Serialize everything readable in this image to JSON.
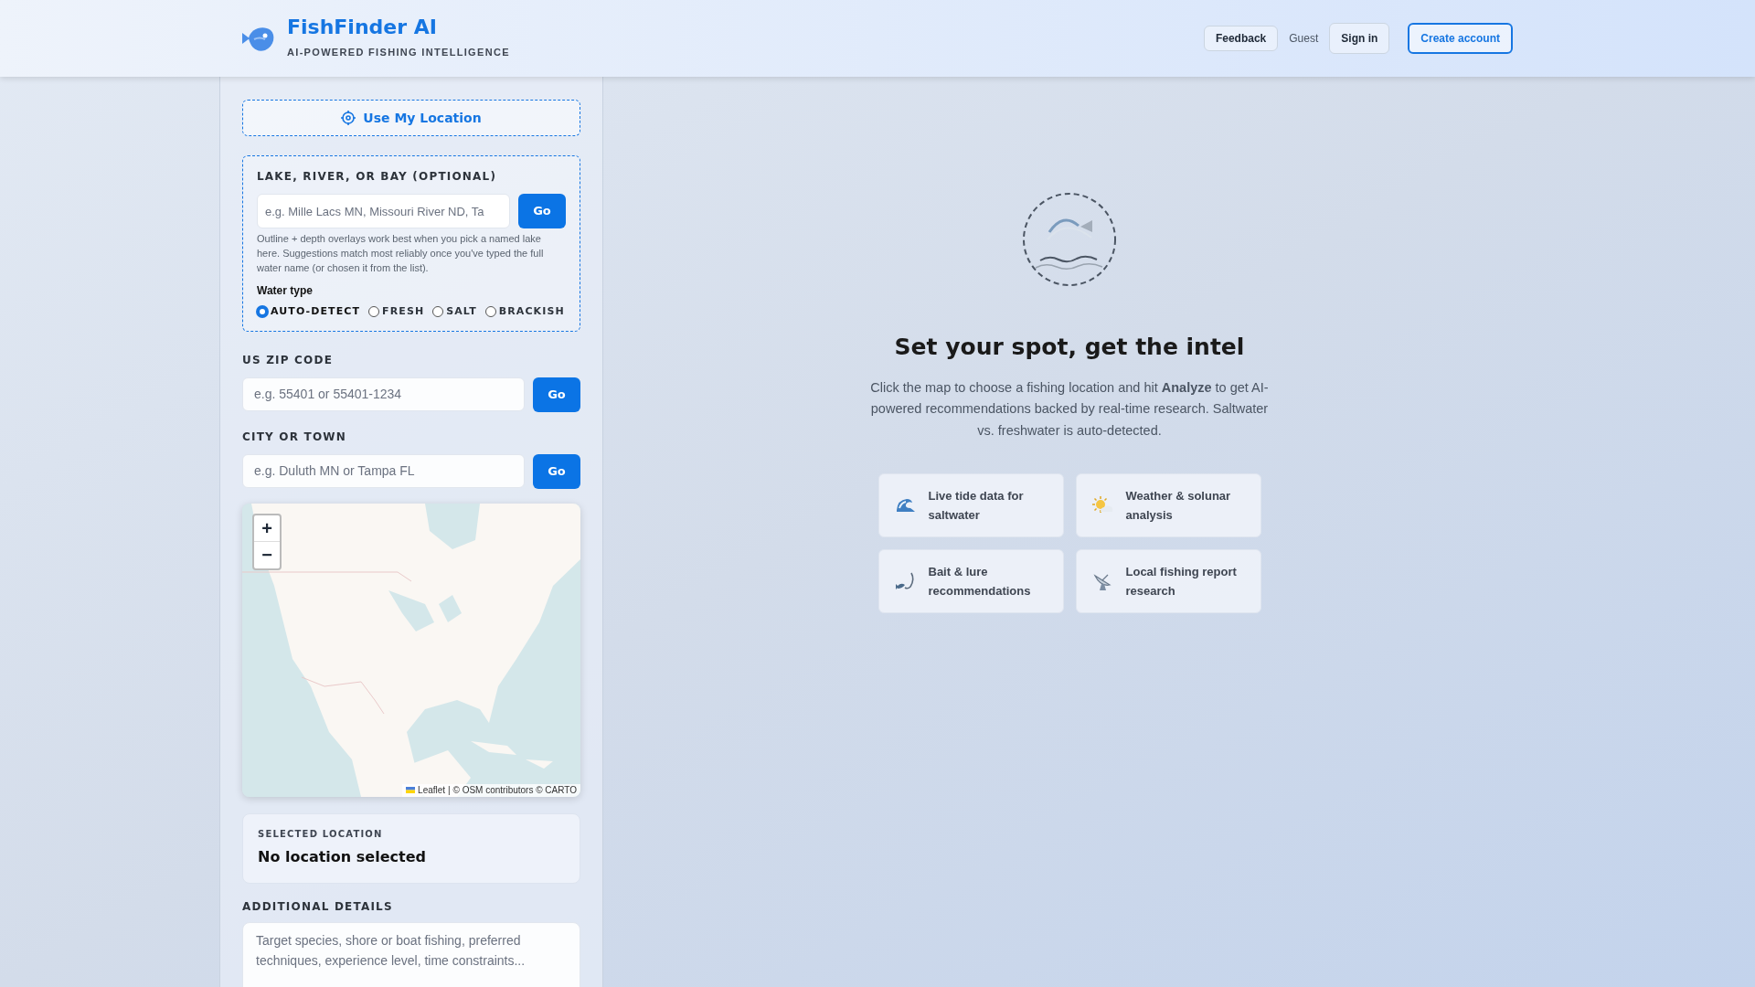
{
  "header": {
    "title": "FishFinder AI",
    "tagline": "AI-POWERED FISHING INTELLIGENCE",
    "feedback": "Feedback",
    "user": "Guest",
    "sign_in": "Sign in",
    "create_account": "Create account"
  },
  "sidebar": {
    "use_location": "Use My Location",
    "water_search": {
      "label": "LAKE, RIVER, OR BAY (OPTIONAL)",
      "placeholder": "e.g. Mille Lacs MN, Missouri River ND, Ta",
      "button": "Go",
      "hint": "Outline + depth overlays work best when you pick a named lake here. Suggestions match most reliably once you've typed the full water name (or chosen it from the list).",
      "water_type_label": "Water type",
      "water_types": [
        {
          "label": "AUTO-DETECT",
          "selected": true
        },
        {
          "label": "FRESH",
          "selected": false
        },
        {
          "label": "SALT",
          "selected": false
        },
        {
          "label": "BRACKISH",
          "selected": false
        }
      ]
    },
    "zip": {
      "label": "US ZIP CODE",
      "placeholder": "e.g. 55401 or 55401-1234",
      "button": "Go"
    },
    "city": {
      "label": "CITY OR TOWN",
      "placeholder": "e.g. Duluth MN or Tampa FL",
      "button": "Go"
    },
    "map": {
      "zoom_in": "+",
      "zoom_out": "−",
      "attribution_link": "Leaflet",
      "attribution": "| © OSM contributors © CARTO"
    },
    "selected_location": {
      "label": "SELECTED LOCATION",
      "value": "No location selected"
    },
    "details": {
      "label": "ADDITIONAL DETAILS",
      "placeholder": "Target species, shore or boat fishing, preferred techniques, experience level, time constraints..."
    }
  },
  "main": {
    "heading": "Set your spot, get the intel",
    "intro": "Click the map to choose a fishing location and hit **Analyze** to get AI-powered recommendations backed by real-time research. Saltwater vs. freshwater is auto-detected.",
    "features": [
      {
        "kind": "wave",
        "label": "Live tide data for saltwater"
      },
      {
        "kind": "sun",
        "label": "Weather & solunar analysis"
      },
      {
        "kind": "hook",
        "label": "Bait & lure recommendations"
      },
      {
        "kind": "dish",
        "label": "Local fishing report research"
      }
    ]
  }
}
